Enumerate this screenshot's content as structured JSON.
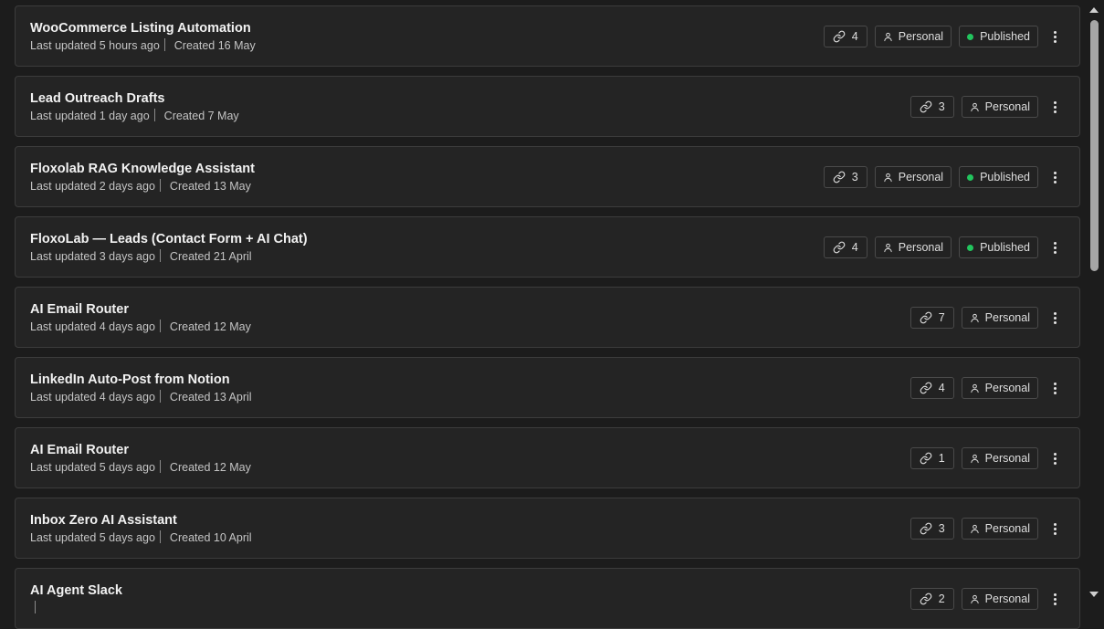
{
  "colors": {
    "background": "#1c1c1c",
    "card": "#242424",
    "published_dot": "#22c55e"
  },
  "icons": {
    "count": "link-icon",
    "owner": "person-icon",
    "status": "green-dot",
    "menu": "kebab-icon"
  },
  "workflows": [
    {
      "title": "WooCommerce Listing Automation",
      "updated": "Last updated 5 hours ago",
      "created": "Created 16 May",
      "count": "4",
      "owner": "Personal",
      "status": "Published"
    },
    {
      "title": "Lead Outreach Drafts",
      "updated": "Last updated 1 day ago",
      "created": "Created 7 May",
      "count": "3",
      "owner": "Personal",
      "status": ""
    },
    {
      "title": "Floxolab RAG Knowledge Assistant",
      "updated": "Last updated 2 days ago",
      "created": "Created 13 May",
      "count": "3",
      "owner": "Personal",
      "status": "Published"
    },
    {
      "title": "FloxoLab — Leads (Contact Form + AI Chat)",
      "updated": "Last updated 3 days ago",
      "created": "Created 21 April",
      "count": "4",
      "owner": "Personal",
      "status": "Published"
    },
    {
      "title": "AI Email Router",
      "updated": "Last updated 4 days ago",
      "created": "Created 12 May",
      "count": "7",
      "owner": "Personal",
      "status": ""
    },
    {
      "title": "LinkedIn Auto-Post from Notion",
      "updated": "Last updated 4 days ago",
      "created": "Created 13 April",
      "count": "4",
      "owner": "Personal",
      "status": ""
    },
    {
      "title": "AI Email Router",
      "updated": "Last updated 5 days ago",
      "created": "Created 12 May",
      "count": "1",
      "owner": "Personal",
      "status": ""
    },
    {
      "title": "Inbox Zero AI Assistant",
      "updated": "Last updated 5 days ago",
      "created": "Created 10 April",
      "count": "3",
      "owner": "Personal",
      "status": ""
    },
    {
      "title": "AI Agent Slack",
      "updated": "",
      "created": "",
      "count": "2",
      "owner": "Personal",
      "status": ""
    }
  ]
}
